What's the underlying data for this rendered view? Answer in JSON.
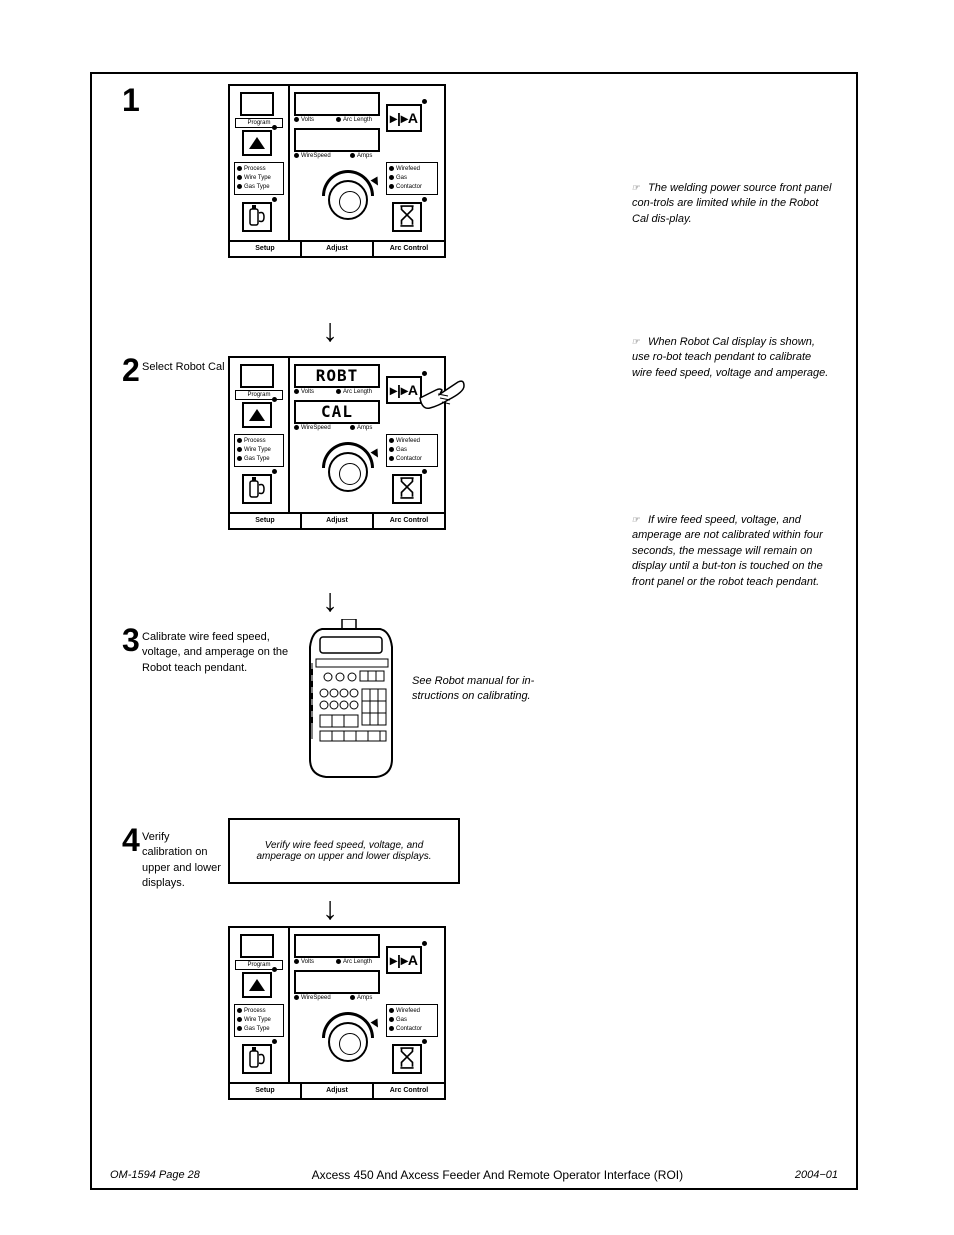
{
  "panel": {
    "program_label": "Program",
    "process": "Process",
    "wiretype": "Wire Type",
    "gastype": "Gas Type",
    "volts": "Volts",
    "arclength": "Arc Length",
    "wirespeed": "WireSpeed",
    "amps": "Amps",
    "wirefeed": "Wirefeed",
    "gas": "Gas",
    "contactor": "Contactor",
    "va_label": "▸|▸A",
    "footer": {
      "setup": "Setup",
      "adjust": "Adjust",
      "arccontrol": "Arc Control"
    }
  },
  "display_step2": {
    "top": "ROBT",
    "bottom": "CAL"
  },
  "steps": {
    "s2": "Select Robot Cal",
    "s3": "Calibrate wire feed speed, voltage, and amperage on the Robot teach pendant.",
    "s4": "Verify calibration on upper and lower displays."
  },
  "s3_pendant_note": "See Robot manual for in-structions on calibrating.",
  "verify_box": "Verify wire feed speed, voltage, and amperage on upper and lower displays.",
  "footer": {
    "left": "OM-1594 Page 28",
    "mid": "Axcess 450 And Axcess Feeder And Remote Operator Interface (ROI)",
    "right": "2004−01"
  },
  "notes": {
    "n1": "The welding power source front panel con-trols are limited while in the Robot Cal dis-play.",
    "n2": "When Robot Cal display is shown, use ro-bot teach pendant to calibrate wire feed speed, voltage and amperage.",
    "n3": "If wire feed speed, voltage, and amperage are not calibrated within four seconds, the message will remain on display until a but-ton is touched on the front panel or the robot teach pendant."
  }
}
